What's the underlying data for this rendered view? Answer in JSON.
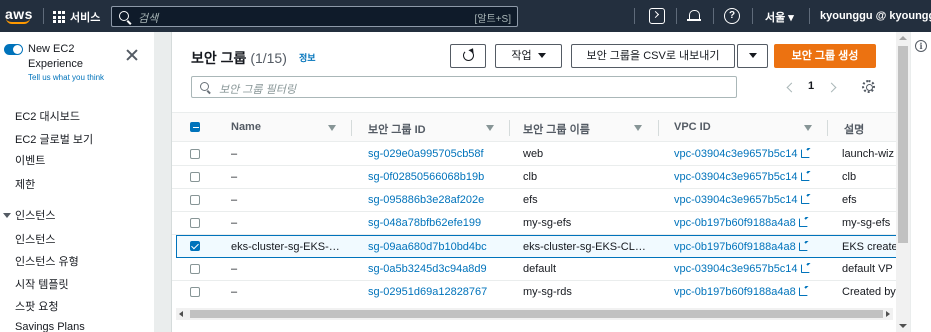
{
  "nav": {
    "logo": "aws",
    "services_label": "서비스",
    "search_placeholder": "검색",
    "search_shortcut": "[알트+S]",
    "help_glyph": "?",
    "region": "서울 ▾",
    "account": "kyounggu @ kyounggu ▾"
  },
  "sidebar": {
    "title": "New EC2 Experience",
    "tell_us": "Tell us what you think",
    "items": [
      "EC2 대시보드",
      "EC2 글로벌 보기",
      "이벤트",
      "제한"
    ],
    "section": "인스턴스",
    "section_items": [
      "인스턴스",
      "인스턴스 유형",
      "시작 템플릿",
      "스팟 요청",
      "Savings Plans"
    ]
  },
  "panel": {
    "title": "보안 그룹",
    "count": "(1/15)",
    "info": "정보",
    "actions_label": "작업",
    "export_label": "보안 그룹을 CSV로 내보내기",
    "create_label": "보안 그룹 생성",
    "filter_placeholder": "보안 그룹 필터링",
    "page": "1",
    "accent": "#ec7211",
    "link_color": "#0073bb"
  },
  "table": {
    "columns": [
      "Name",
      "보안 그룹 ID",
      "보안 그룹 이름",
      "VPC ID",
      "설명"
    ],
    "rows": [
      {
        "name": "–",
        "id": "sg-029e0a995705cb58f",
        "sgname": "web",
        "vpc": "vpc-03904c3e9657b5c14",
        "desc": "launch-wiz",
        "selected": false
      },
      {
        "name": "–",
        "id": "sg-0f02850566068b19b",
        "sgname": "clb",
        "vpc": "vpc-03904c3e9657b5c14",
        "desc": "clb",
        "selected": false
      },
      {
        "name": "–",
        "id": "sg-095886b3e28af202e",
        "sgname": "efs",
        "vpc": "vpc-03904c3e9657b5c14",
        "desc": "efs",
        "selected": false
      },
      {
        "name": "–",
        "id": "sg-048a78bfb62efe199",
        "sgname": "my-sg-efs",
        "vpc": "vpc-0b197b60f9188a4a8",
        "desc": "my-sg-efs",
        "selected": false
      },
      {
        "name": "eks-cluster-sg-EKS-…",
        "id": "sg-09aa680d7b10bd4bc",
        "sgname": "eks-cluster-sg-EKS-CL…",
        "vpc": "vpc-0b197b60f9188a4a8",
        "desc": "EKS create",
        "selected": true
      },
      {
        "name": "–",
        "id": "sg-0a5b3245d3c94a8d9",
        "sgname": "default",
        "vpc": "vpc-03904c3e9657b5c14",
        "desc": "default VP",
        "selected": false
      },
      {
        "name": "–",
        "id": "sg-02951d69a12828767",
        "sgname": "my-sg-rds",
        "vpc": "vpc-0b197b60f9188a4a8",
        "desc": "Created by",
        "selected": false
      }
    ]
  },
  "rightbar": {
    "info_glyph": "i"
  }
}
